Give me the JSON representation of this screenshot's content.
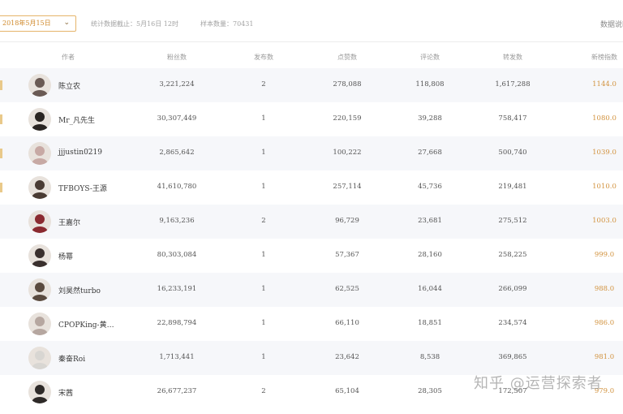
{
  "toolbar": {
    "date_value": "2018年5月15日",
    "stats_cutoff": "统计数据截止：5月16日 12时",
    "sample_count": "样本数量：70431",
    "right_link": "数据说明"
  },
  "colors": {
    "accent": "#d2933f",
    "row_stripe": "#f6f7fa"
  },
  "table": {
    "columns": [
      "作者",
      "粉丝数",
      "发布数",
      "点赞数",
      "评论数",
      "转发数",
      "新榜指数"
    ],
    "rows": [
      {
        "author": "陈立农",
        "fans": "3,221,224",
        "posts": "2",
        "likes": "278,088",
        "comments": "118,808",
        "reposts": "1,617,288",
        "index": "1144.0",
        "avatar_color": "#6a5a54"
      },
      {
        "author": "Mr_凡先生",
        "fans": "30,307,449",
        "posts": "1",
        "likes": "220,159",
        "comments": "39,288",
        "reposts": "758,417",
        "index": "1080.0",
        "avatar_color": "#2a2522"
      },
      {
        "author": "jjjustin0219",
        "fans": "2,865,642",
        "posts": "1",
        "likes": "100,222",
        "comments": "27,668",
        "reposts": "500,740",
        "index": "1039.0",
        "avatar_color": "#c7a9a4"
      },
      {
        "author": "TFBOYS-王源",
        "fans": "41,610,780",
        "posts": "1",
        "likes": "257,114",
        "comments": "45,736",
        "reposts": "219,481",
        "index": "1010.0",
        "avatar_color": "#4a3c34"
      },
      {
        "author": "王嘉尔",
        "fans": "9,163,236",
        "posts": "2",
        "likes": "96,729",
        "comments": "23,681",
        "reposts": "275,512",
        "index": "1003.0",
        "avatar_color": "#8a2a30"
      },
      {
        "author": "杨幂",
        "fans": "80,303,084",
        "posts": "1",
        "likes": "57,367",
        "comments": "28,160",
        "reposts": "258,225",
        "index": "999.0",
        "avatar_color": "#3a302e"
      },
      {
        "author": "刘昊然turbo",
        "fans": "16,233,191",
        "posts": "1",
        "likes": "62,525",
        "comments": "16,044",
        "reposts": "266,099",
        "index": "988.0",
        "avatar_color": "#5a4a3e"
      },
      {
        "author": "CPOPKing-黄…",
        "fans": "22,898,794",
        "posts": "1",
        "likes": "66,110",
        "comments": "18,851",
        "reposts": "234,574",
        "index": "986.0",
        "avatar_color": "#b6a7a0"
      },
      {
        "author": "秦奋Roi",
        "fans": "1,713,441",
        "posts": "1",
        "likes": "23,642",
        "comments": "8,538",
        "reposts": "369,865",
        "index": "981.0",
        "avatar_color": "#d8d6d2"
      },
      {
        "author": "宋茜",
        "fans": "26,677,237",
        "posts": "2",
        "likes": "65,104",
        "comments": "28,305",
        "reposts": "172,507",
        "index": "979.0",
        "avatar_color": "#2e2a28"
      }
    ]
  },
  "watermark": "知乎 @运营探索者"
}
